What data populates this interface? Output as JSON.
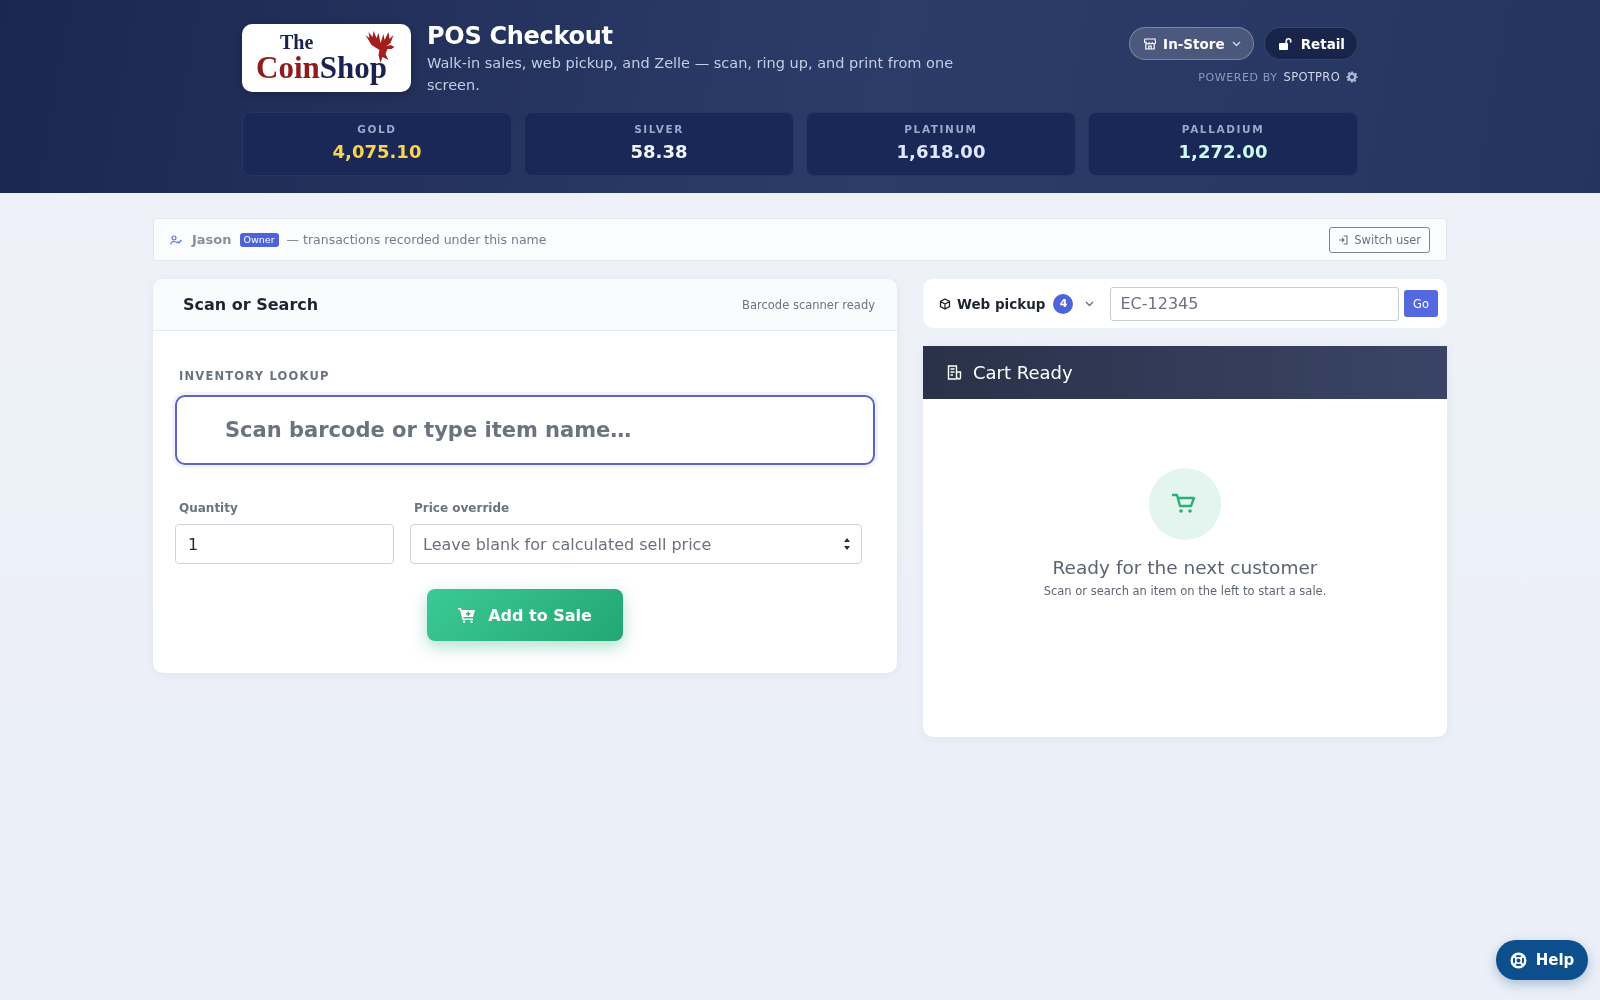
{
  "header": {
    "logo": {
      "small_text": "The",
      "text_1": "Coin",
      "text_2": "Shop"
    },
    "title": "POS Checkout",
    "subtitle": "Walk-in sales, web pickup, and Zelle — scan, ring up, and print from one screen.",
    "mode_button": {
      "label": "In-Store"
    },
    "pricing_button": {
      "label": "Retail"
    },
    "powered_by": {
      "label": "POWERED BY",
      "brand": "SPOTPRO"
    }
  },
  "metals": [
    {
      "name": "GOLD",
      "price": "4,075.10",
      "color": "#fcd34d"
    },
    {
      "name": "SILVER",
      "price": "58.38",
      "color": "#f1f5f9"
    },
    {
      "name": "PLATINUM",
      "price": "1,618.00",
      "color": "#e0e7ff"
    },
    {
      "name": "PALLADIUM",
      "price": "1,272.00",
      "color": "#ccfbf1"
    }
  ],
  "user_bar": {
    "name": "Jason",
    "role": "Owner",
    "note": "— transactions recorded under this name",
    "switch_button": "Switch user"
  },
  "scan_panel": {
    "title": "Scan or Search",
    "status": "Barcode scanner ready",
    "lookup_label": "INVENTORY LOOKUP",
    "lookup_field": {
      "placeholder": "Scan barcode or type item name…"
    },
    "quantity": {
      "label": "Quantity",
      "value": "1"
    },
    "price_override": {
      "label": "Price override",
      "placeholder": "Leave blank for calculated sell price"
    },
    "add_button": "Add to Sale"
  },
  "pickup_bar": {
    "label": "Web pickup",
    "count": "4",
    "order_field": {
      "placeholder": "EC-12345"
    },
    "go_button": "Go"
  },
  "cart": {
    "title": "Cart Ready",
    "empty_title": "Ready for the next customer",
    "empty_text": "Scan or search an item on the left to start a sale."
  },
  "help_button": "Help"
}
